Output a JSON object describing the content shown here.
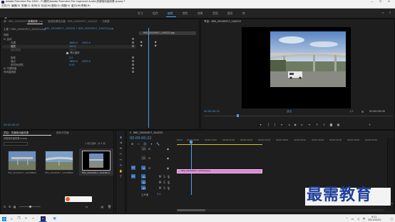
{
  "title_bar": {
    "text": "Adobe Premiere Pro 2020 - F:\\素材\\Adobe Premiere Pro Captured Audio\\关键帧动画效果.prproj *"
  },
  "menu": [
    "文件(F)",
    "编辑(E)",
    "剪辑(C)",
    "序列(S)",
    "标记(M)",
    "图形(G)",
    "视图(V)",
    "窗口(W)",
    "帮助(H)"
  ],
  "workspace_tabs": [
    "学习",
    "组件",
    "编辑",
    "颜色",
    "效果",
    "音频",
    "图形",
    "库"
  ],
  "active_workspace": "编辑",
  "effect_controls": {
    "tabs": [
      "源：IMG_20200917_104222.jpg",
      "效果控件",
      "音频剪辑混合器：IMG_20200917_104222",
      "元数据"
    ],
    "master": "主要 * IMG_20200917_104222.jpg",
    "clip": "IMG_20200917_104222 * IMG_20200917_104222.jpg",
    "clip_bar_label": "IMG_20200917_104222.jpg",
    "section_video": "视频",
    "motion": "fx 运动",
    "position_label": "位置",
    "position_values": [
      "1680.0",
      "1050.0"
    ],
    "scale_label": "缩放",
    "scale_value": "100.0",
    "scale_width_label": "缩放宽度",
    "scale_width_value": "100.0",
    "uniform_scale": "等比缩放",
    "rotation_label": "旋转",
    "rotation_value": "0.0",
    "anchor_label": "锚点",
    "anchor_values": [
      "1680.0",
      "1050.0"
    ],
    "antiflicker_label": "防闪烁滤镜",
    "antiflicker_value": "0.00",
    "opacity": "fx 不透明度",
    "time_remap": "时间重映射",
    "timecode": "00:00:00:22"
  },
  "program_monitor": {
    "title": "节目：IMG_20200917_104222",
    "timecode": "00:00:00:22",
    "fit": "适合",
    "fraction": "1/2",
    "duration": "00:00:05:00"
  },
  "project_panel": {
    "tabs": [
      "项目：关键帧动画效果",
      "媒体浏览器"
    ],
    "path": "关键帧动画效果.prproj",
    "item_count": "1 项已选择，共 3 项",
    "items": [
      {
        "name": "IMG_20200917_104203...",
        "duration": "5:00"
      },
      {
        "name": "IMG_20200917_104213...",
        "duration": "5:00"
      },
      {
        "name": "IMG_20200917_104222...",
        "duration": "5:00"
      }
    ]
  },
  "timeline": {
    "tab": "IMG_20200917_104222",
    "timecode": "00:00:00:22",
    "ruler": [
      "00:00",
      "00:00:05:00",
      "00:00:10:00",
      "00:00:15:00",
      "00:00:20:00",
      "00:00:25:00",
      "00:00:30:00",
      "00:00:35:00",
      "00:00:40:00",
      "00:00:45:00",
      "00:00:50:00",
      "00:00:55:00"
    ],
    "video_tracks": [
      "V3",
      "V2",
      "V1"
    ],
    "audio_tracks": [
      "A1",
      "A2",
      "A3"
    ],
    "master": "主声道",
    "master_value": "0.0",
    "clip_name": "IMG_20200917_104222.jpg"
  },
  "watermark": "最需教育",
  "taskbar": {
    "time": "9:11",
    "date": "2021/10/22"
  },
  "colors": {
    "accent": "#4f9fe6",
    "clip": "#d98ad4",
    "track_button": "#2f6aa8",
    "playhead": "#4f9fe6"
  }
}
